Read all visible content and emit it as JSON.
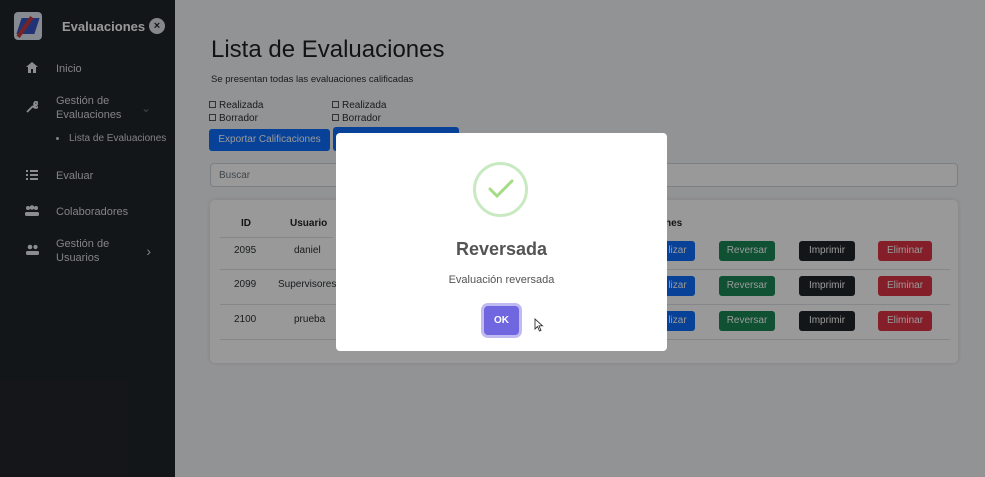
{
  "sidebar": {
    "title": "Evaluaciones",
    "items": [
      {
        "label": "Inicio",
        "icon": "home-icon"
      },
      {
        "label": "Gestión de Evaluaciones",
        "icon": "wrench-icon"
      },
      {
        "label": "Evaluar",
        "icon": "list-icon"
      },
      {
        "label": "Colaboradores",
        "icon": "team-icon"
      },
      {
        "label": "Gestión de Usuarios",
        "icon": "users-icon"
      }
    ],
    "subitems": [
      {
        "label": "Lista de Evaluaciones"
      }
    ]
  },
  "main": {
    "title": "Lista de Evaluaciones",
    "subtitle": "Se presentan todas las evaluaciones calificadas",
    "filters_left": [
      "Realizada",
      "Borrador"
    ],
    "filters_right": [
      "Realizada",
      "Borrador"
    ],
    "export_label": "Exportar Calificaciones",
    "search_placeholder": "Buscar",
    "table": {
      "columns": [
        "ID",
        "Usuario",
        "nes"
      ],
      "rows": [
        {
          "id": "2095",
          "usuario": "daniel"
        },
        {
          "id": "2099",
          "usuario": "Supervisores"
        },
        {
          "id": "2100",
          "usuario": "prueba"
        }
      ],
      "actions": {
        "first": "lizar",
        "reverse": "Reversar",
        "print": "Imprimir",
        "delete": "Eliminar"
      }
    }
  },
  "modal": {
    "title": "Reversada",
    "text": "Evaluación reversada",
    "ok_label": "OK"
  },
  "colors": {
    "primary": "#0d6efd",
    "success": "#198754",
    "dark": "#212529",
    "danger": "#dc3545",
    "confirm": "#7066e0"
  }
}
